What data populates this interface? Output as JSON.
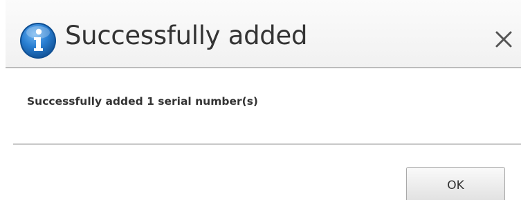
{
  "dialog": {
    "title": "Successfully added",
    "icon": "info-icon",
    "message": "Successfully added 1 serial number(s)",
    "close_icon": "close-icon",
    "ok_label": "OK"
  },
  "colors": {
    "icon_blue": "#1f73c8",
    "title_text": "#333333",
    "divider": "#c8c8c8"
  }
}
